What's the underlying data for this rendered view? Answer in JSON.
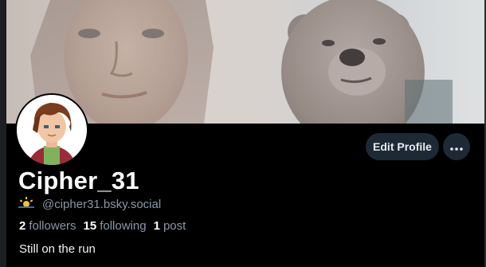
{
  "profile": {
    "display_name": "Cipher_31",
    "handle": "@cipher31.bsky.social",
    "handle_badge_icon": "sun-cloud-icon",
    "stats": {
      "followers_count": "2",
      "followers_label": "followers",
      "following_count": "15",
      "following_label": "following",
      "posts_count": "1",
      "posts_label": "post"
    },
    "bio": "Still on the run"
  },
  "actions": {
    "edit_profile_label": "Edit Profile",
    "more_icon": "ellipsis-icon"
  },
  "colors": {
    "background": "#000000",
    "button_bg": "#1e2936",
    "muted_text": "#8a98a8",
    "primary_text": "#ffffff"
  }
}
